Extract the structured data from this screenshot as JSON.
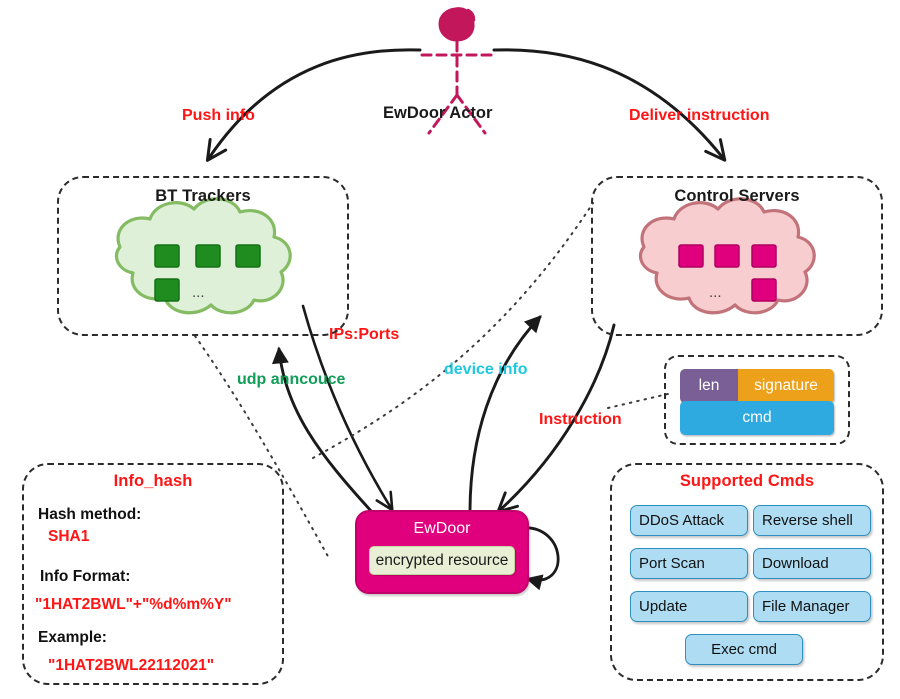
{
  "title": "EwDoor botnet infrastructure diagram",
  "actor": {
    "label": "EwDoor Actor"
  },
  "edges": {
    "push_info": "Push info",
    "deliver_instruction": "Deliver instruction",
    "ips_ports": "IPs:Ports",
    "udp_announce": "udp anncouce",
    "device_info": "device info",
    "instruction": "Instruction"
  },
  "bt_trackers": {
    "title": "BT Trackers",
    "ellipsis": "...",
    "node_count": 4
  },
  "control_servers": {
    "title": "Control Servers",
    "ellipsis": "...",
    "node_count": 4
  },
  "packet": {
    "len": "len",
    "signature": "signature",
    "cmd": "cmd"
  },
  "ewdoor": {
    "title": "EwDoor",
    "resource": "encrypted resource"
  },
  "info_hash": {
    "title": "Info_hash",
    "rows": [
      {
        "key": "Hash method:",
        "value": "SHA1"
      },
      {
        "key": "Info Format:",
        "value": "\"1HAT2BWL\"+\"%d%m%Y\""
      },
      {
        "key": "Example:",
        "value": "\"1HAT2BWL22112021\""
      }
    ]
  },
  "supported_cmds": {
    "title": "Supported Cmds",
    "items": [
      "DDoS Attack",
      "Reverse shell",
      "Port Scan",
      "Download",
      "Update",
      "File Manager",
      "Exec cmd"
    ]
  },
  "colors": {
    "accent_magenta": "#e0007d",
    "label_red": "#ff1515",
    "label_green": "#0f9d58",
    "label_cyan": "#1ec8e0",
    "tracker_green": "#1e8c1e",
    "cloud_green_fill": "#dff0d8",
    "cloud_pink_fill": "#f7cdd0",
    "server_magenta": "#e0007d",
    "cmd_chip_blue": "#aedcf3",
    "packet_len_purple": "#7a5f96",
    "packet_sig_orange": "#eda01a",
    "packet_cmd_blue": "#2eaae1"
  }
}
